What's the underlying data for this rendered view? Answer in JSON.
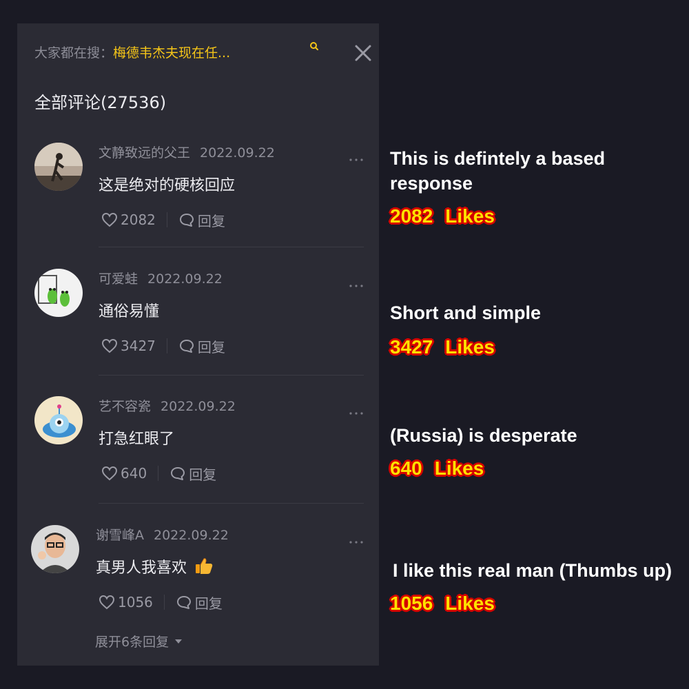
{
  "header": {
    "search_prefix": "大家都在搜：",
    "search_term": "梅德韦杰夫现在任...",
    "comments_title": "全部评论(27536)"
  },
  "comments": [
    {
      "username": "文静致远的父王",
      "date": "2022.09.22",
      "text": "这是绝对的硬核回应",
      "likes": "2082",
      "reply_label": "回复"
    },
    {
      "username": "可爱蛙",
      "date": "2022.09.22",
      "text": "通俗易懂",
      "likes": "3427",
      "reply_label": "回复"
    },
    {
      "username": "艺不容瓷",
      "date": "2022.09.22",
      "text": "打急红眼了",
      "likes": "640",
      "reply_label": "回复"
    },
    {
      "username": "谢雪峰A",
      "date": "2022.09.22",
      "text": "真男人我喜欢",
      "likes": "1056",
      "reply_label": "回复",
      "emoji": "thumbs-up-icon"
    }
  ],
  "expand_replies": "展开6条回复",
  "annotations": [
    {
      "text": "This is defintely a based response",
      "likes": "2082",
      "likes_label": "Likes"
    },
    {
      "text": "Short and simple",
      "likes": "3427",
      "likes_label": "Likes"
    },
    {
      "text": "(Russia) is desperate",
      "likes": "640",
      "likes_label": "Likes"
    },
    {
      "text": "I like this real man (Thumbs up)",
      "likes": "1056",
      "likes_label": "Likes"
    }
  ],
  "colors": {
    "background": "#1a1a24",
    "panel": "#2b2b34",
    "highlight": "#f5c518",
    "likes_fill": "#ffe100",
    "likes_outline": "#d40000"
  }
}
